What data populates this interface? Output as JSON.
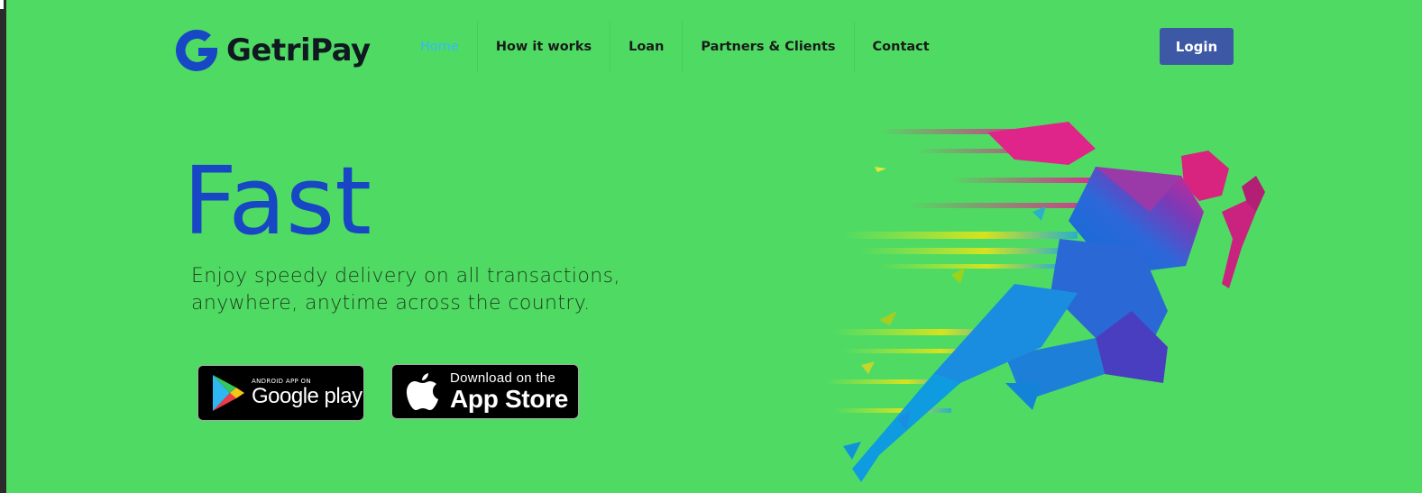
{
  "brand": {
    "name": "GetriPay",
    "logo_color": "#1747c4"
  },
  "nav": {
    "items": [
      {
        "label": "Home",
        "active": true
      },
      {
        "label": "How it works",
        "active": false
      },
      {
        "label": "Loan",
        "active": false
      },
      {
        "label": "Partners & Clients",
        "active": false
      },
      {
        "label": "Contact",
        "active": false
      }
    ]
  },
  "header": {
    "login_label": "Login"
  },
  "hero": {
    "title": "Fast",
    "subtitle_line1": "Enjoy speedy delivery on all transactions,",
    "subtitle_line2": "anywhere, anytime across the country."
  },
  "badges": {
    "google": {
      "small": "ANDROID APP ON",
      "big": "Google play",
      "icon": "google-play-icon"
    },
    "apple": {
      "small": "Download on the",
      "big": "App Store",
      "icon": "apple-icon"
    }
  },
  "colors": {
    "background": "#4fdb63",
    "title": "#1747c4",
    "nav_active": "#36b8ff",
    "login_button": "#3d59a6"
  },
  "illustration": {
    "icon": "running-man-illustration"
  }
}
